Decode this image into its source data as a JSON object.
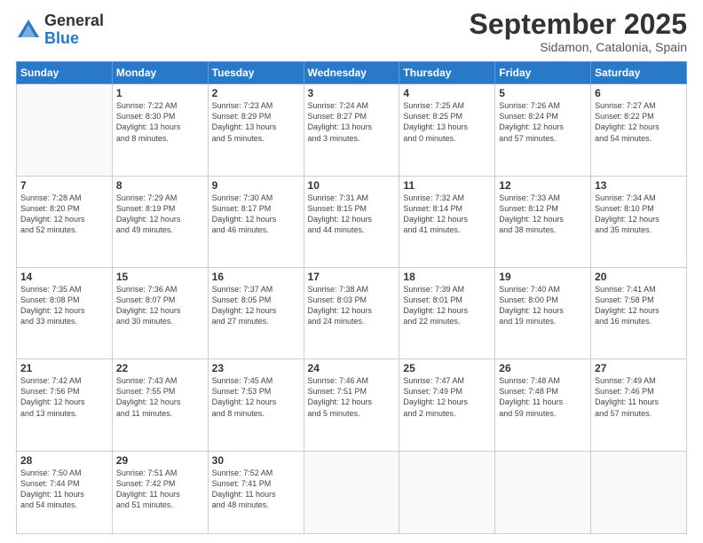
{
  "header": {
    "logo": {
      "general": "General",
      "blue": "Blue"
    },
    "title": "September 2025",
    "location": "Sidamon, Catalonia, Spain"
  },
  "days_of_week": [
    "Sunday",
    "Monday",
    "Tuesday",
    "Wednesday",
    "Thursday",
    "Friday",
    "Saturday"
  ],
  "weeks": [
    [
      {
        "day": "",
        "info": ""
      },
      {
        "day": "1",
        "info": "Sunrise: 7:22 AM\nSunset: 8:30 PM\nDaylight: 13 hours\nand 8 minutes."
      },
      {
        "day": "2",
        "info": "Sunrise: 7:23 AM\nSunset: 8:29 PM\nDaylight: 13 hours\nand 5 minutes."
      },
      {
        "day": "3",
        "info": "Sunrise: 7:24 AM\nSunset: 8:27 PM\nDaylight: 13 hours\nand 3 minutes."
      },
      {
        "day": "4",
        "info": "Sunrise: 7:25 AM\nSunset: 8:25 PM\nDaylight: 13 hours\nand 0 minutes."
      },
      {
        "day": "5",
        "info": "Sunrise: 7:26 AM\nSunset: 8:24 PM\nDaylight: 12 hours\nand 57 minutes."
      },
      {
        "day": "6",
        "info": "Sunrise: 7:27 AM\nSunset: 8:22 PM\nDaylight: 12 hours\nand 54 minutes."
      }
    ],
    [
      {
        "day": "7",
        "info": "Sunrise: 7:28 AM\nSunset: 8:20 PM\nDaylight: 12 hours\nand 52 minutes."
      },
      {
        "day": "8",
        "info": "Sunrise: 7:29 AM\nSunset: 8:19 PM\nDaylight: 12 hours\nand 49 minutes."
      },
      {
        "day": "9",
        "info": "Sunrise: 7:30 AM\nSunset: 8:17 PM\nDaylight: 12 hours\nand 46 minutes."
      },
      {
        "day": "10",
        "info": "Sunrise: 7:31 AM\nSunset: 8:15 PM\nDaylight: 12 hours\nand 44 minutes."
      },
      {
        "day": "11",
        "info": "Sunrise: 7:32 AM\nSunset: 8:14 PM\nDaylight: 12 hours\nand 41 minutes."
      },
      {
        "day": "12",
        "info": "Sunrise: 7:33 AM\nSunset: 8:12 PM\nDaylight: 12 hours\nand 38 minutes."
      },
      {
        "day": "13",
        "info": "Sunrise: 7:34 AM\nSunset: 8:10 PM\nDaylight: 12 hours\nand 35 minutes."
      }
    ],
    [
      {
        "day": "14",
        "info": "Sunrise: 7:35 AM\nSunset: 8:08 PM\nDaylight: 12 hours\nand 33 minutes."
      },
      {
        "day": "15",
        "info": "Sunrise: 7:36 AM\nSunset: 8:07 PM\nDaylight: 12 hours\nand 30 minutes."
      },
      {
        "day": "16",
        "info": "Sunrise: 7:37 AM\nSunset: 8:05 PM\nDaylight: 12 hours\nand 27 minutes."
      },
      {
        "day": "17",
        "info": "Sunrise: 7:38 AM\nSunset: 8:03 PM\nDaylight: 12 hours\nand 24 minutes."
      },
      {
        "day": "18",
        "info": "Sunrise: 7:39 AM\nSunset: 8:01 PM\nDaylight: 12 hours\nand 22 minutes."
      },
      {
        "day": "19",
        "info": "Sunrise: 7:40 AM\nSunset: 8:00 PM\nDaylight: 12 hours\nand 19 minutes."
      },
      {
        "day": "20",
        "info": "Sunrise: 7:41 AM\nSunset: 7:58 PM\nDaylight: 12 hours\nand 16 minutes."
      }
    ],
    [
      {
        "day": "21",
        "info": "Sunrise: 7:42 AM\nSunset: 7:56 PM\nDaylight: 12 hours\nand 13 minutes."
      },
      {
        "day": "22",
        "info": "Sunrise: 7:43 AM\nSunset: 7:55 PM\nDaylight: 12 hours\nand 11 minutes."
      },
      {
        "day": "23",
        "info": "Sunrise: 7:45 AM\nSunset: 7:53 PM\nDaylight: 12 hours\nand 8 minutes."
      },
      {
        "day": "24",
        "info": "Sunrise: 7:46 AM\nSunset: 7:51 PM\nDaylight: 12 hours\nand 5 minutes."
      },
      {
        "day": "25",
        "info": "Sunrise: 7:47 AM\nSunset: 7:49 PM\nDaylight: 12 hours\nand 2 minutes."
      },
      {
        "day": "26",
        "info": "Sunrise: 7:48 AM\nSunset: 7:48 PM\nDaylight: 11 hours\nand 59 minutes."
      },
      {
        "day": "27",
        "info": "Sunrise: 7:49 AM\nSunset: 7:46 PM\nDaylight: 11 hours\nand 57 minutes."
      }
    ],
    [
      {
        "day": "28",
        "info": "Sunrise: 7:50 AM\nSunset: 7:44 PM\nDaylight: 11 hours\nand 54 minutes."
      },
      {
        "day": "29",
        "info": "Sunrise: 7:51 AM\nSunset: 7:42 PM\nDaylight: 11 hours\nand 51 minutes."
      },
      {
        "day": "30",
        "info": "Sunrise: 7:52 AM\nSunset: 7:41 PM\nDaylight: 11 hours\nand 48 minutes."
      },
      {
        "day": "",
        "info": ""
      },
      {
        "day": "",
        "info": ""
      },
      {
        "day": "",
        "info": ""
      },
      {
        "day": "",
        "info": ""
      }
    ]
  ]
}
